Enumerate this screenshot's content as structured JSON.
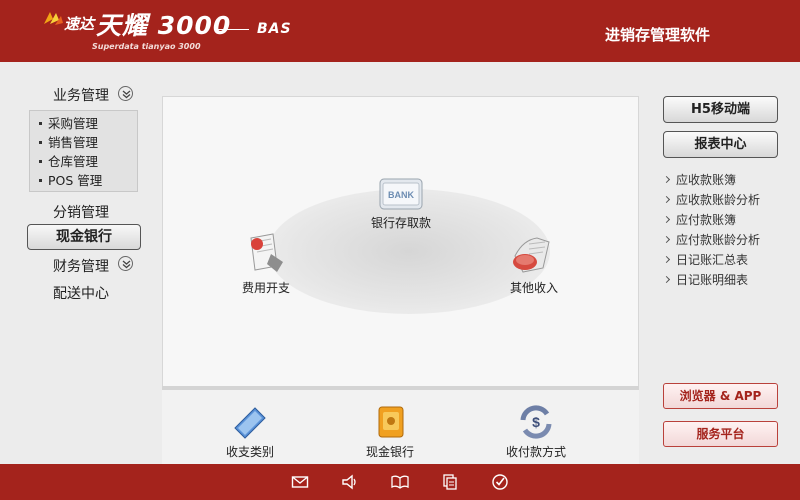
{
  "header": {
    "brand_cn": "速达",
    "product_title": "天耀 3000",
    "subtitle": "Superdata tianyao 3000",
    "edition": "BAS",
    "app_name": "进销存管理软件"
  },
  "sidebar": {
    "groups": [
      {
        "label": "业务管理",
        "expanded": true
      },
      {
        "label": "分销管理"
      },
      {
        "label": "现金银行",
        "active": true
      },
      {
        "label": "财务管理"
      },
      {
        "label": "配送中心"
      }
    ],
    "sub_items": [
      "采购管理",
      "销售管理",
      "仓库管理",
      "POS 管理"
    ]
  },
  "center": {
    "nodes": [
      {
        "label": "银行存取款",
        "icon": "bank-icon",
        "badge": "BANK"
      },
      {
        "label": "费用开支",
        "icon": "expense-icon"
      },
      {
        "label": "其他收入",
        "icon": "income-icon"
      }
    ],
    "bottom": [
      {
        "label": "收支类别",
        "icon": "book-icon"
      },
      {
        "label": "现金银行",
        "icon": "safe-icon"
      },
      {
        "label": "收付款方式",
        "icon": "payment-icon"
      }
    ]
  },
  "right": {
    "top_buttons": [
      "H5移动端",
      "报表中心"
    ],
    "links": [
      "应收款账簿",
      "应收款账龄分析",
      "应付款账簿",
      "应付款账龄分析",
      "日记账汇总表",
      "日记账明细表"
    ],
    "bottom_buttons": [
      "浏览器 & APP",
      "服务平台"
    ]
  },
  "footer": {
    "icons": [
      "mail-icon",
      "speaker-icon",
      "book-open-icon",
      "copy-icon",
      "check-icon"
    ]
  },
  "colors": {
    "brand": "#a4231c",
    "background": "#ececec",
    "panel": "#f7f7f7"
  }
}
